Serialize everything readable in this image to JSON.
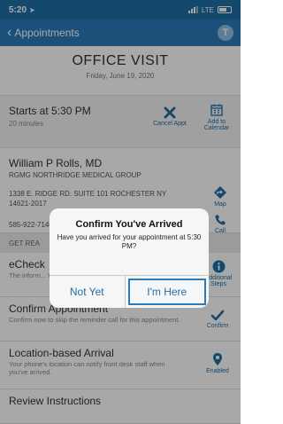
{
  "status_bar": {
    "time": "5:20",
    "network": "LTE"
  },
  "nav": {
    "back_label": "Appointments",
    "avatar_initial": "T"
  },
  "header": {
    "title": "OFFICE VISIT",
    "date": "Friday, June 19, 2020"
  },
  "starts": {
    "label": "Starts at 5:30 PM",
    "duration": "20 minutes",
    "cancel_label": "Cancel Appt",
    "calendar_label": "Add to Calendar"
  },
  "provider": {
    "name": "William P Rolls, MD",
    "group": "RGMG NORTHRIDGE MEDICAL GROUP",
    "address": "1338 E. RIDGE RD. SUITE 101 ROCHESTER NY 14621-2017",
    "phone": "585-922-7140",
    "map_label": "Map",
    "call_label": "Call"
  },
  "section_header": "GET REA",
  "items": [
    {
      "title": "eCheck",
      "desc": "The inform... When you... steps to c...",
      "action": "Additional Steps"
    },
    {
      "title": "Confirm Appointment",
      "desc": "Confirm now to skip the reminder call for this appointment.",
      "action": "Confirm"
    },
    {
      "title": "Location-based Arrival",
      "desc": "Your phone's location can notify front desk staff when you've arrived.",
      "action": "Enabled"
    },
    {
      "title": "Review Instructions"
    }
  ],
  "dialog": {
    "title": "Confirm You've Arrived",
    "message": "Have you arrived for your appointment at 5:30 PM?",
    "cancel": "Not Yet",
    "confirm": "I'm Here"
  },
  "colors": {
    "accent": "#1f6fa8",
    "nav": "#2a7ab9"
  }
}
